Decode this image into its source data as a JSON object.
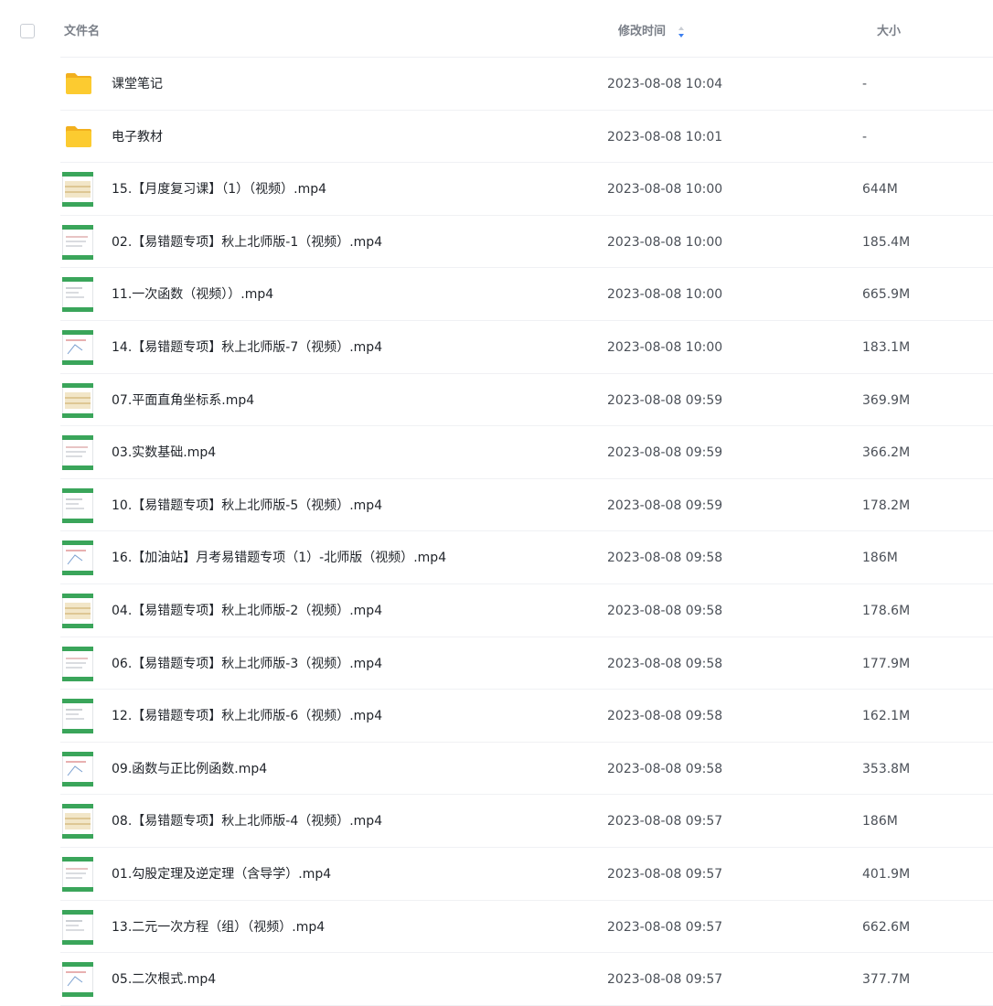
{
  "header": {
    "name_label": "文件名",
    "time_label": "修改时间",
    "size_label": "大小"
  },
  "colors": {
    "accent": "#3d7ff0",
    "folder": "#fccb30",
    "thumb_green": "#3aa55a"
  },
  "files": [
    {
      "name": "课堂笔记",
      "time": "2023-08-08 10:04",
      "size": "-",
      "type": "folder",
      "icon": "folder-icon"
    },
    {
      "name": "电子教材",
      "time": "2023-08-08 10:01",
      "size": "-",
      "type": "folder",
      "icon": "folder-icon"
    },
    {
      "name": "15.【月度复习课】（1）（视频）.mp4",
      "time": "2023-08-08 10:00",
      "size": "644M",
      "type": "video",
      "icon": "video-thumbnail-icon"
    },
    {
      "name": "02.【易错题专项】秋上北师版-1（视频）.mp4",
      "time": "2023-08-08 10:00",
      "size": "185.4M",
      "type": "video",
      "icon": "video-thumbnail-icon"
    },
    {
      "name": "11.一次函数（视频））.mp4",
      "time": "2023-08-08 10:00",
      "size": "665.9M",
      "type": "video",
      "icon": "video-thumbnail-icon"
    },
    {
      "name": "14.【易错题专项】秋上北师版-7（视频）.mp4",
      "time": "2023-08-08 10:00",
      "size": "183.1M",
      "type": "video",
      "icon": "video-thumbnail-icon"
    },
    {
      "name": "07.平面直角坐标系.mp4",
      "time": "2023-08-08 09:59",
      "size": "369.9M",
      "type": "video",
      "icon": "video-thumbnail-icon"
    },
    {
      "name": "03.实数基础.mp4",
      "time": "2023-08-08 09:59",
      "size": "366.2M",
      "type": "video",
      "icon": "video-thumbnail-icon"
    },
    {
      "name": "10.【易错题专项】秋上北师版-5（视频）.mp4",
      "time": "2023-08-08 09:59",
      "size": "178.2M",
      "type": "video",
      "icon": "video-thumbnail-icon"
    },
    {
      "name": "16.【加油站】月考易错题专项（1）-北师版（视频）.mp4",
      "time": "2023-08-08 09:58",
      "size": "186M",
      "type": "video",
      "icon": "video-thumbnail-icon"
    },
    {
      "name": "04.【易错题专项】秋上北师版-2（视频）.mp4",
      "time": "2023-08-08 09:58",
      "size": "178.6M",
      "type": "video",
      "icon": "video-thumbnail-icon"
    },
    {
      "name": "06.【易错题专项】秋上北师版-3（视频）.mp4",
      "time": "2023-08-08 09:58",
      "size": "177.9M",
      "type": "video",
      "icon": "video-thumbnail-icon"
    },
    {
      "name": "12.【易错题专项】秋上北师版-6（视频）.mp4",
      "time": "2023-08-08 09:58",
      "size": "162.1M",
      "type": "video",
      "icon": "video-thumbnail-icon"
    },
    {
      "name": "09.函数与正比例函数.mp4",
      "time": "2023-08-08 09:58",
      "size": "353.8M",
      "type": "video",
      "icon": "video-thumbnail-icon"
    },
    {
      "name": "08.【易错题专项】秋上北师版-4（视频）.mp4",
      "time": "2023-08-08 09:57",
      "size": "186M",
      "type": "video",
      "icon": "video-thumbnail-icon"
    },
    {
      "name": "01.勾股定理及逆定理（含导学）.mp4",
      "time": "2023-08-08 09:57",
      "size": "401.9M",
      "type": "video",
      "icon": "video-thumbnail-icon"
    },
    {
      "name": "13.二元一次方程（组）（视频）.mp4",
      "time": "2023-08-08 09:57",
      "size": "662.6M",
      "type": "video",
      "icon": "video-thumbnail-icon"
    },
    {
      "name": "05.二次根式.mp4",
      "time": "2023-08-08 09:57",
      "size": "377.7M",
      "type": "video",
      "icon": "video-thumbnail-icon"
    }
  ]
}
